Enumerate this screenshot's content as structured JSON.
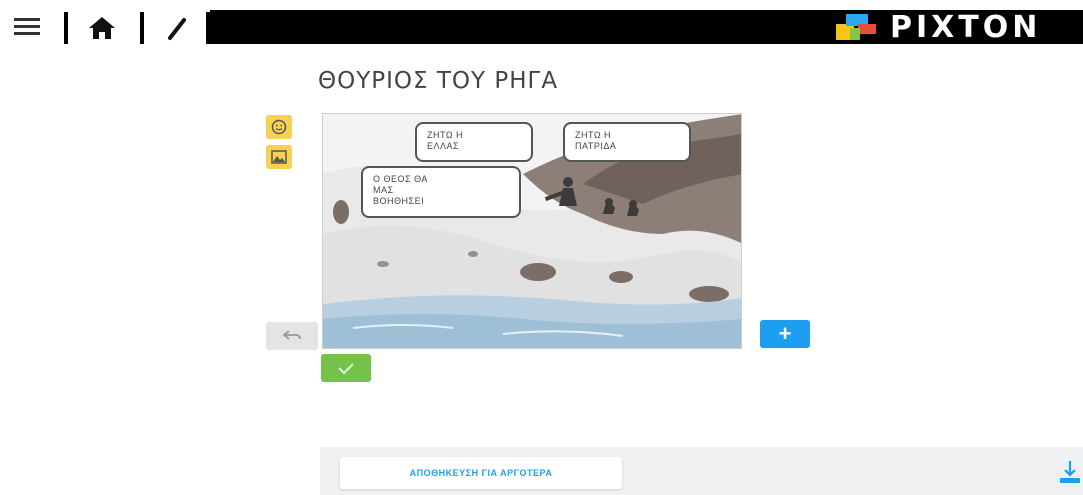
{
  "topbar": {
    "menu_icon": "hamburger-menu-icon",
    "home_icon": "home-icon",
    "edit_icon": "pencil-icon",
    "brand": "PIXTON",
    "brand_colors": [
      "#f5c518",
      "#2aa8f2",
      "#8ac541",
      "#e94e3d"
    ]
  },
  "comic": {
    "title": "ΘΟΥΡΙΟΣ ΤΟΥ ΡΗΓΑ",
    "bubbles": [
      "ΖΗΤΩ Η\nΕΛΛΑΣ",
      "ΖΗΤΩ Η\nΠΑΤΡΙΔΑ",
      "Ο ΘΕΟΣ ΘΑ\nΜΑΣ\nΒΟΗΘΗΣΕΙ"
    ]
  },
  "tools": {
    "emotion_icon": "smiley-face-icon",
    "background_icon": "image-icon",
    "undo_icon": "undo-icon",
    "add_label": "+",
    "confirm_icon": "checkmark-icon"
  },
  "footer": {
    "save_later_label": "ΑΠΟΘΗΚΕΥΣΗ ΓΙΑ ΑΡΓΟΤΕΡΑ",
    "download_icon": "download-icon"
  },
  "colors": {
    "accent_blue": "#1e9ef0",
    "tool_yellow": "#f7d154",
    "confirm_green": "#74c24a"
  }
}
